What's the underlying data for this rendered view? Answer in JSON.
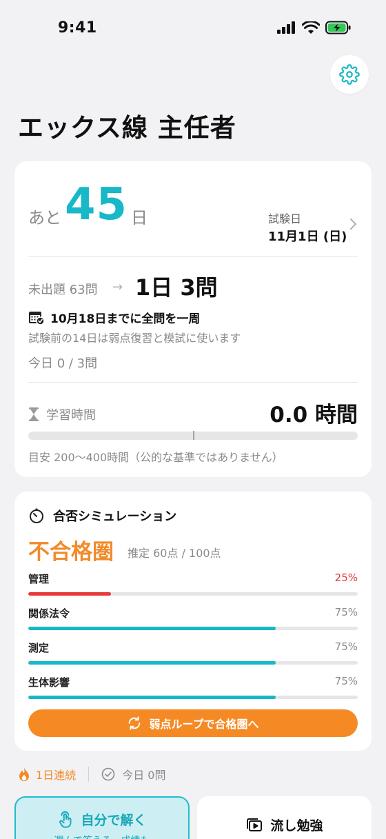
{
  "status_bar": {
    "time": "9:41"
  },
  "header": {
    "title": "エックス線 主任者",
    "settings_icon": "gear-icon"
  },
  "countdown": {
    "prefix": "あと",
    "days": "45",
    "suffix": "日",
    "exam_label": "試験日",
    "exam_date": "11月1日 (日)"
  },
  "plan": {
    "unasked": "未出題 63問",
    "arrow": "→",
    "per_day": "1日 3問",
    "target": "10月18日までに全問を一周",
    "note": "試験前の14日は弱点復習と模試に使います",
    "today": "今日 0 / 3問"
  },
  "study": {
    "label": "学習時間",
    "hours": "0.0 時間",
    "progress": 0,
    "note": "目安 200〜400時間（公的な基準ではありません）"
  },
  "simulation": {
    "title": "合否シミュレーション",
    "status": "不合格圏",
    "estimate": "推定 60点 / 100点",
    "subjects": [
      {
        "name": "管理",
        "pct": "25%",
        "value": 0.25,
        "color": "#e63a3a"
      },
      {
        "name": "関係法令",
        "pct": "75%",
        "value": 0.75,
        "color": "#17b8c8"
      },
      {
        "name": "測定",
        "pct": "75%",
        "value": 0.75,
        "color": "#17b8c8"
      },
      {
        "name": "生体影響",
        "pct": "75%",
        "value": 0.75,
        "color": "#17b8c8"
      }
    ],
    "button_label": "弱点ループで合格圏へ"
  },
  "streak": {
    "days": "1日連続",
    "today": "今日 0問"
  },
  "actions": {
    "self_solve": "自分で解く",
    "self_solve_sub": "選んで答える・成績も",
    "flow_study": "流し勉強"
  },
  "colors": {
    "accent": "#17b8c8",
    "orange": "#f58a24",
    "red": "#e63a3a"
  }
}
